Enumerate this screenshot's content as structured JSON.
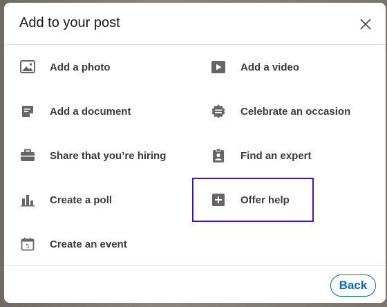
{
  "dialog": {
    "title": "Add to your post",
    "close_icon": "close-icon",
    "back_label": "Back"
  },
  "items": {
    "add_photo": {
      "label": "Add a photo",
      "icon": "image-icon"
    },
    "add_video": {
      "label": "Add a video",
      "icon": "video-icon"
    },
    "add_document": {
      "label": "Add a document",
      "icon": "document-icon"
    },
    "celebrate": {
      "label": "Celebrate an occasion",
      "icon": "celebrate-icon"
    },
    "hiring": {
      "label": "Share that you’re hiring",
      "icon": "briefcase-icon"
    },
    "expert": {
      "label": "Find an expert",
      "icon": "badge-icon"
    },
    "poll": {
      "label": "Create a poll",
      "icon": "bar-chart-icon"
    },
    "offer_help": {
      "label": "Offer help",
      "icon": "plus-box-icon"
    },
    "event": {
      "label": "Create an event",
      "icon": "calendar-icon"
    }
  },
  "colors": {
    "accent": "#0a66c2",
    "highlight": "#3c14d6",
    "icon": "#666666"
  }
}
